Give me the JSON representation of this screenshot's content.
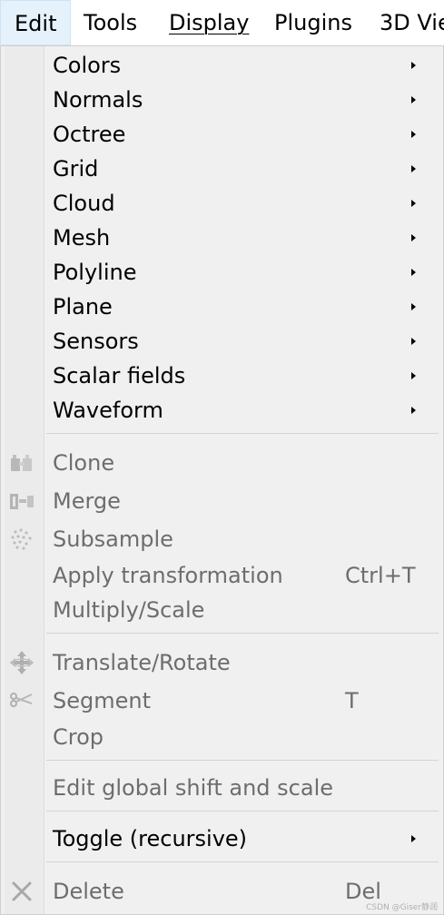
{
  "menubar": {
    "items": [
      "Edit",
      "Tools",
      "Display",
      "Plugins",
      "3D Vie"
    ]
  },
  "menu": {
    "submenus": [
      "Colors",
      "Normals",
      "Octree",
      "Grid",
      "Cloud",
      "Mesh",
      "Polyline",
      "Plane",
      "Sensors",
      "Scalar fields",
      "Waveform"
    ],
    "clone": "Clone",
    "merge": "Merge",
    "subsample": "Subsample",
    "apply_transformation": "Apply transformation",
    "apply_transformation_shortcut": "Ctrl+T",
    "multiply_scale": "Multiply/Scale",
    "translate_rotate": "Translate/Rotate",
    "segment": "Segment",
    "segment_shortcut": "T",
    "crop": "Crop",
    "edit_global_shift": "Edit global shift and scale",
    "toggle_recursive": "Toggle (recursive)",
    "delete": "Delete",
    "delete_shortcut": "Del"
  },
  "watermark": "CSDN @Giser静润",
  "icons": {
    "clone": "clone-icon",
    "merge": "merge-icon",
    "subsample": "subsample-icon",
    "translate_rotate": "move-icon",
    "segment": "scissors-icon",
    "delete": "close-icon"
  }
}
